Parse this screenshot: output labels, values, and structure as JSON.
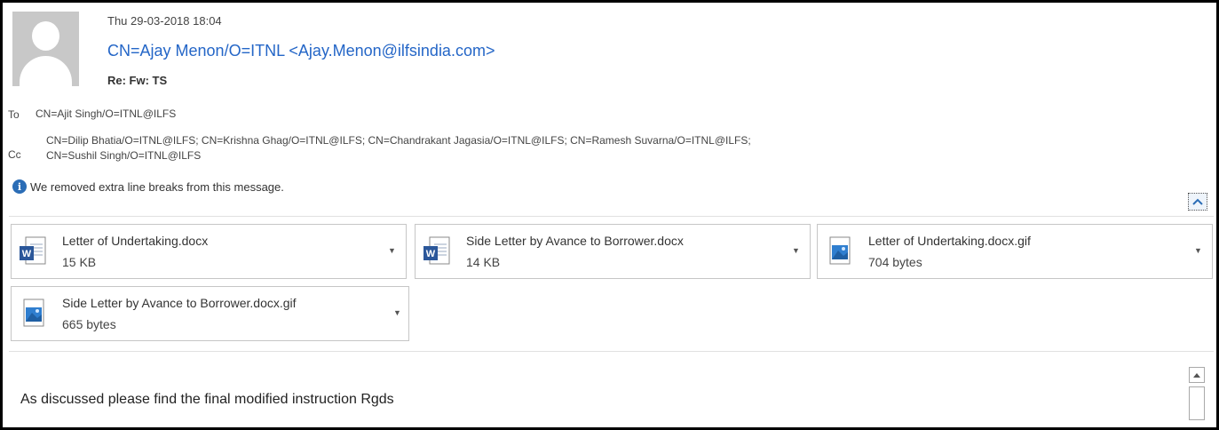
{
  "header": {
    "date": "Thu 29-03-2018 18:04",
    "from": "CN=Ajay Menon/O=ITNL <Ajay.Menon@ilfsindia.com>",
    "subject": "Re: Fw: TS"
  },
  "recipients": {
    "to_label": "To",
    "to_value": "CN=Ajit Singh/O=ITNL@ILFS",
    "cc_label": "Cc",
    "cc_value_line1": "CN=Dilip Bhatia/O=ITNL@ILFS; CN=Krishna Ghag/O=ITNL@ILFS; CN=Chandrakant Jagasia/O=ITNL@ILFS; CN=Ramesh Suvarna/O=ITNL@ILFS;",
    "cc_value_line2": "CN=Sushil Singh/O=ITNL@ILFS"
  },
  "info_bar": {
    "icon": "info-icon",
    "text": "We removed extra line breaks from this message."
  },
  "attachments": [
    {
      "name": "Letter of Undertaking.docx",
      "size": "15 KB",
      "icon": "word-doc-icon"
    },
    {
      "name": "Side Letter by Avance to Borrower.docx",
      "size": "14 KB",
      "icon": "word-doc-icon"
    },
    {
      "name": "Letter of Undertaking.docx.gif",
      "size": "704 bytes",
      "icon": "image-file-icon"
    },
    {
      "name": "Side Letter by Avance to Borrower.docx.gif",
      "size": "665 bytes",
      "icon": "image-file-icon"
    }
  ],
  "message": {
    "body": "As discussed please find the final modified instruction Rgds"
  },
  "colors": {
    "sender_link": "#2466c7",
    "info_icon": "#2b6db6",
    "word_blue": "#2b579a"
  }
}
